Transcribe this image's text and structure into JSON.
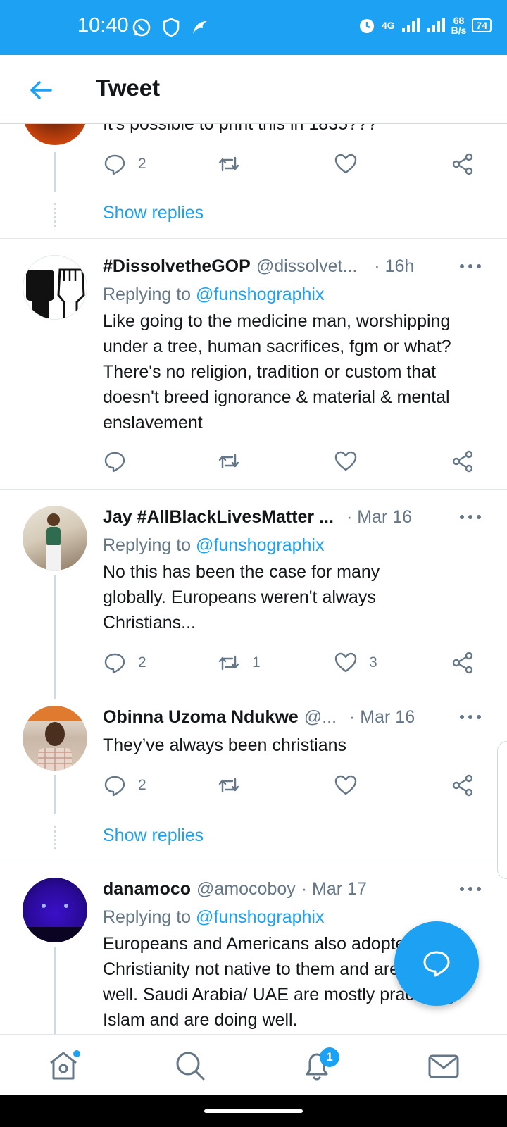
{
  "status_bar": {
    "time": "10:40",
    "network": "4G",
    "data_speed_value": "68",
    "data_speed_unit": "B/s",
    "battery": "74"
  },
  "header": {
    "title": "Tweet"
  },
  "tweets": [
    {
      "partial_text": "It's possible to print this in 1835???",
      "reply_count": "2",
      "retweet_count": "",
      "like_count": ""
    },
    {
      "name": "#DissolvetheGOP",
      "handle": "@dissolvet...",
      "date": "· 16h",
      "replying_label": "Replying to",
      "replying_handle": "@funshographix",
      "text": "Like going to the medicine man, worshipping under a tree, human sacrifices, fgm or what? There's no religion, tradition or custom that doesn't breed ignorance & material & mental enslavement",
      "reply_count": "",
      "retweet_count": "",
      "like_count": ""
    },
    {
      "name": "Jay #AllBlackLivesMatter ...",
      "handle": "",
      "date": "· Mar 16",
      "replying_label": "Replying to",
      "replying_handle": "@funshographix",
      "text": "No this has been the case for many globally. Europeans weren't always Christians...",
      "reply_count": "2",
      "retweet_count": "1",
      "like_count": "3"
    },
    {
      "name": "Obinna Uzoma Ndukwe",
      "handle": "@...",
      "date": "· Mar 16",
      "text": "They’ve always been christians",
      "reply_count": "2",
      "retweet_count": "",
      "like_count": ""
    },
    {
      "name": "danamoco",
      "handle": "@amocoboy",
      "date": "· Mar 17",
      "replying_label": "Replying to",
      "replying_handle": "@funshographix",
      "text": "Europeans and Americans also adopted Christianity not native to them and are doing well. Saudi Arabia/ UAE are mostly practicing Islam and are doing well."
    }
  ],
  "show_replies_label": "Show replies",
  "tab_bar": {
    "notifications_badge": "1"
  },
  "colors": {
    "accent": "#1da1f2",
    "secondary_text": "#657786"
  }
}
